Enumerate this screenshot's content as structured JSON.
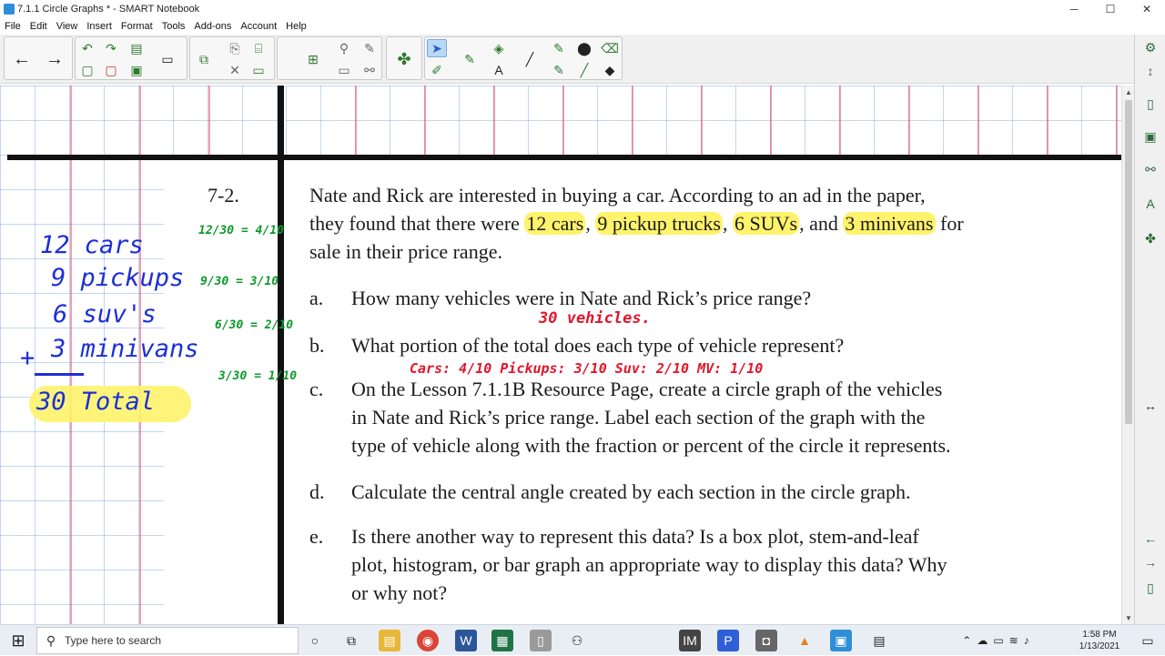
{
  "window": {
    "title": "7.1.1 Circle Graphs * - SMART Notebook",
    "minimize": "─",
    "maximize": "☐",
    "close": "✕"
  },
  "menu": [
    "File",
    "Edit",
    "View",
    "Insert",
    "Format",
    "Tools",
    "Add-ons",
    "Account",
    "Help"
  ],
  "problem": {
    "number": "7-2.",
    "intro_line1": "Nate and Rick are interested in buying a car.  According to an ad in the paper,",
    "intro_line2_pre": "they found that there were ",
    "hl_cars": "12 cars",
    "sep1": ", ",
    "hl_pickups": "9 pickup trucks",
    "sep2": ", ",
    "hl_suvs": "6 SUVs",
    "sep3": ", and ",
    "hl_minivans": "3 minivans",
    "intro_line2_post": " for",
    "intro_line3": "sale in their price range.",
    "parts": [
      {
        "label": "a.",
        "lines": [
          "How many vehicles were in Nate and Rick’s price range?"
        ]
      },
      {
        "label": "b.",
        "lines": [
          "What portion of the total does each type of vehicle represent?"
        ]
      },
      {
        "label": "c.",
        "lines": [
          "On the Lesson 7.1.1B Resource Page, create a circle graph of the vehicles",
          "in Nate and Rick’s price range.  Label each section of the graph with the",
          "type of vehicle along with the fraction or percent of the circle it represents."
        ]
      },
      {
        "label": "d.",
        "lines": [
          "Calculate the central angle created by each section in the circle graph."
        ]
      },
      {
        "label": "e.",
        "lines": [
          "Is there another way to represent this data?  Is a box plot, stem-and-leaf",
          "plot, histogram, or bar graph an appropriate way to display this data?  Why",
          "or why not?"
        ]
      }
    ]
  },
  "handwriting": {
    "blue": [
      "12 cars",
      "9 pickups",
      "6 suv's",
      "3 minivans",
      "+",
      "30 Total"
    ],
    "green": [
      "12/30 = 4/10",
      "9/30 = 3/10",
      "6/30 = 2/10",
      "3/30 = 1/10"
    ],
    "red_answer_a": "30 vehicles.",
    "red_answer_b": "Cars: 4/10   Pickups: 3/10   Suv: 2/10   MV: 1/10"
  },
  "taskbar": {
    "search_placeholder": "Type here to search",
    "time": "1:58 PM",
    "date": "1/13/2021"
  },
  "colors": {
    "highlight": "#fff36b",
    "ink_blue": "#1c2fd6",
    "ink_green": "#0c9a2a",
    "ink_red": "#e0162b"
  }
}
